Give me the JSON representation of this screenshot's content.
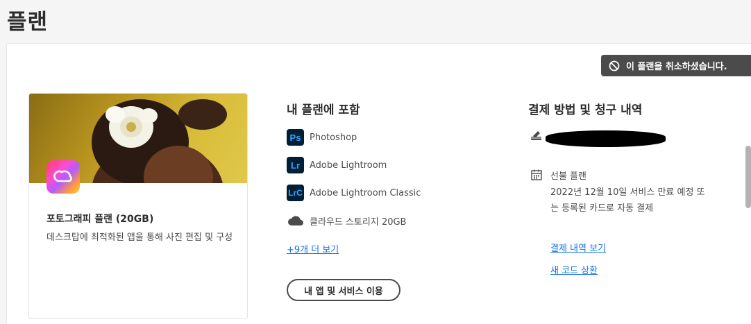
{
  "page": {
    "title": "플랜"
  },
  "toast": {
    "message": "이 플랜을 취소하셨습니다."
  },
  "plan_card": {
    "title": "포토그래피 플랜 (20GB)",
    "description": "데스크탑에 최적화된 앱을 통해 사진 편집 및 구성"
  },
  "included": {
    "heading": "내 플랜에 포함",
    "apps": [
      {
        "badge": "Ps",
        "label": "Photoshop"
      },
      {
        "badge": "Lr",
        "label": "Adobe Lightroom"
      },
      {
        "badge": "LrC",
        "label": "Adobe Lightroom Classic"
      }
    ],
    "storage_label": "클라우드 스토리지 20GB",
    "more_link": "+9개 더 보기",
    "use_button": "내 앱 및 서비스 이용"
  },
  "billing": {
    "heading": "결제 방법 및 청구 내역",
    "plan_type": "선불 플랜",
    "expiry_note_1": "2022년 12월 10일 서비스 만료 예정 또",
    "expiry_note_2": "는 등록된 카드로 자동 결제",
    "history_link": "결제 내역 보기",
    "redeem_link": "새 코드 상환"
  },
  "colors": {
    "toast_bg": "#4b4b4b",
    "link": "#1473e6",
    "ps_badge_bg": "#001e36",
    "ps_badge_fg": "#31a8ff"
  }
}
